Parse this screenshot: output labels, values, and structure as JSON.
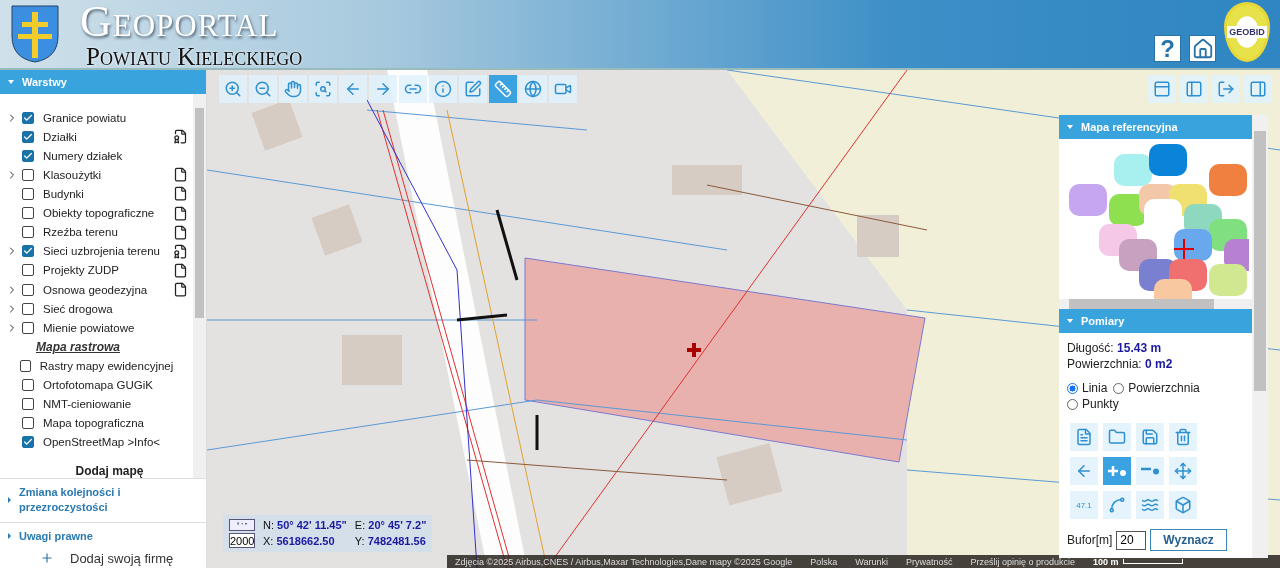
{
  "header": {
    "title": "Geoportal",
    "subtitle": "Powiatu Kieleckiego",
    "logo_text": "GEOBID",
    "buttons": [
      {
        "kind": "help",
        "label": "?"
      },
      {
        "kind": "home"
      }
    ]
  },
  "layers_panel": {
    "title": "Warstwy",
    "expanded": true,
    "items": [
      {
        "kind": "layer",
        "label": "Granice powiatu",
        "expandable": true,
        "checked": true,
        "document": false
      },
      {
        "kind": "layer",
        "label": "Działki",
        "expandable": false,
        "checked": true,
        "document": true,
        "info": true
      },
      {
        "kind": "layer",
        "label": "Numery działek",
        "expandable": false,
        "checked": true,
        "document": false
      },
      {
        "kind": "layer",
        "label": "Klasoużytki",
        "expandable": true,
        "checked": false,
        "document": true,
        "info": false
      },
      {
        "kind": "layer",
        "label": "Budynki",
        "expandable": false,
        "checked": false,
        "document": true,
        "info": false
      },
      {
        "kind": "layer",
        "label": "Obiekty topograficzne",
        "expandable": false,
        "checked": false,
        "document": true,
        "info": false
      },
      {
        "kind": "layer",
        "label": "Rzeźba terenu",
        "expandable": false,
        "checked": false,
        "document": true,
        "info": false
      },
      {
        "kind": "layer",
        "label": "Sieci uzbrojenia terenu",
        "expandable": true,
        "checked": true,
        "document": true,
        "info": true
      },
      {
        "kind": "layer",
        "label": "Projekty ZUDP",
        "expandable": false,
        "checked": false,
        "document": true,
        "info": false
      },
      {
        "kind": "layer",
        "label": "Osnowa geodezyjna",
        "expandable": true,
        "checked": false,
        "document": true,
        "info": false
      },
      {
        "kind": "layer",
        "label": "Sieć drogowa",
        "expandable": true,
        "checked": false,
        "document": false
      },
      {
        "kind": "layer",
        "label": "Mienie powiatowe",
        "expandable": true,
        "checked": false,
        "document": false
      },
      {
        "kind": "heading",
        "label": "Mapa rastrowa"
      },
      {
        "kind": "layer",
        "label": "Rastry mapy ewidencyjnej",
        "expandable": false,
        "checked": false,
        "document": false
      },
      {
        "kind": "layer",
        "label": "Ortofotomapa GUGiK",
        "expandable": false,
        "checked": false,
        "document": false
      },
      {
        "kind": "layer",
        "label": "NMT-cieniowanie",
        "expandable": false,
        "checked": false,
        "document": false
      },
      {
        "kind": "layer",
        "label": "Mapa topograficzna",
        "expandable": false,
        "checked": false,
        "document": false
      },
      {
        "kind": "layer",
        "label": "OpenStreetMap >Info<",
        "expandable": false,
        "checked": true,
        "document": false
      }
    ],
    "add_map": "Dodaj mapę"
  },
  "collapsed_sections": [
    {
      "title": "Zmiana kolejności i przezroczystości",
      "expanded": false
    },
    {
      "title": "Uwagi prawne",
      "expanded": false
    }
  ],
  "below_panel_text": "Dodaj swoją firmę",
  "map_toolbar": [
    {
      "kind": "zoom-in",
      "selected": false
    },
    {
      "kind": "zoom-out",
      "selected": false
    },
    {
      "kind": "pan",
      "selected": false
    },
    {
      "kind": "zoom-extent",
      "selected": false
    },
    {
      "kind": "back",
      "selected": false
    },
    {
      "kind": "forward",
      "selected": false
    },
    {
      "kind": "link",
      "selected": false
    },
    {
      "kind": "info",
      "selected": false
    },
    {
      "kind": "info-box",
      "selected": false
    },
    {
      "kind": "measure",
      "selected": true
    },
    {
      "kind": "globe",
      "selected": false
    },
    {
      "kind": "video",
      "selected": false
    }
  ],
  "layout_buttons": [
    {
      "kind": "top"
    },
    {
      "kind": "left"
    },
    {
      "kind": "exit"
    },
    {
      "kind": "right"
    }
  ],
  "coordinates": {
    "format_label": "° ' \"",
    "scale": "2000",
    "n_label": "N:",
    "n_value": "50° 42' 11.45\"",
    "e_label": "E:",
    "e_value": "20° 45' 7.2\"",
    "x_label": "X:",
    "x_value": "5618662.50",
    "y_label": "Y:",
    "y_value": "7482481.56"
  },
  "attribution": {
    "items": [
      "Zdjęcia ©2025 Airbus,CNES / Airbus,Maxar Technologies,Dane mapy ©2025 Google",
      "Polska",
      "Warunki",
      "Prywatność",
      "Prześlij opinię o produkcie"
    ],
    "scale": "100 m"
  },
  "reference_map": {
    "title": "Mapa referencyjna",
    "expanded": true
  },
  "measure_panel": {
    "title": "Pomiary",
    "expanded": true,
    "length_label": "Długość:",
    "length_value": "15.43 m",
    "area_label": "Powierzchnia:",
    "area_value": "0 m2",
    "modes": [
      {
        "label": "Linia",
        "selected": true
      },
      {
        "label": "Powierzchnia",
        "selected": false
      },
      {
        "label": "Punkty",
        "selected": false
      }
    ],
    "tools": [
      {
        "kind": "new",
        "selected": false
      },
      {
        "kind": "open",
        "selected": false
      },
      {
        "kind": "save",
        "selected": false
      },
      {
        "kind": "delete",
        "selected": false
      },
      {
        "kind": "undo",
        "selected": false
      },
      {
        "kind": "add-point",
        "selected": true
      },
      {
        "kind": "remove-point",
        "selected": false
      },
      {
        "kind": "move",
        "selected": false
      },
      {
        "kind": "label",
        "selected": false,
        "label": "47.1"
      },
      {
        "kind": "polyline",
        "selected": false
      },
      {
        "kind": "profile",
        "selected": false
      },
      {
        "kind": "cube",
        "selected": false
      }
    ],
    "buffer_label": "Bufor[m]",
    "buffer_value": "20",
    "compute_button": "Wyznacz"
  }
}
